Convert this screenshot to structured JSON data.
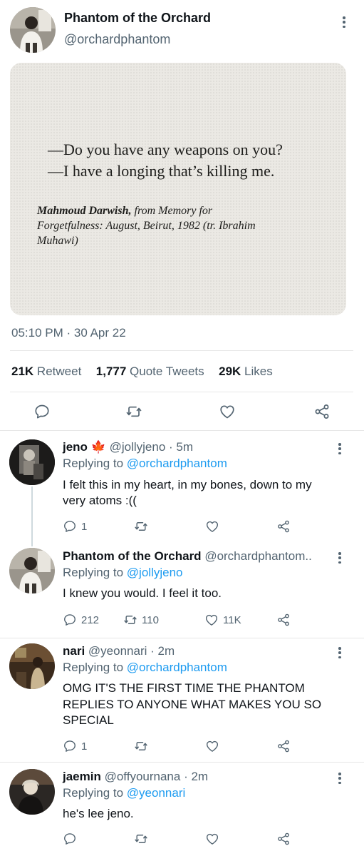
{
  "tweet": {
    "author_name": "Phantom of the Orchard",
    "author_handle": "@orchardphantom",
    "quote_line1": "—Do you have any weapons on you?",
    "quote_line2": "—I have a longing that’s killing me.",
    "attribution_author": "Mahmoud Darwish,",
    "attribution_line1_rest": " from Memory for",
    "attribution_line2": "Forgetfulness: August, Beirut, 1982 (tr. Ibrahim",
    "attribution_line3": "Muhawi)",
    "timestamp": "05:10 PM · 30 Apr 22",
    "stats": {
      "retweets_count": "21K",
      "retweets_label": "Retweet",
      "quotes_count": "1,777",
      "quotes_label": "Quote Tweets",
      "likes_count": "29K",
      "likes_label": "Likes"
    }
  },
  "replies": [
    {
      "name": "jeno",
      "emoji": "🍁",
      "handle": "@jollyjeno",
      "time": "· 5m",
      "replying_prefix": "Replying to",
      "replying_to": "@orchardphantom",
      "text_line1": "I felt this in my heart, in my bones, down to my",
      "text_line2": "very atoms :((",
      "reply_count": "1",
      "retweet_count": "",
      "like_count": ""
    },
    {
      "name": "Phantom of the Orchard",
      "handle": "@orchardphantom..",
      "replying_prefix": "Replying to",
      "replying_to": "@jollyjeno",
      "text_line1": "I knew you would. I feel it too.",
      "reply_count": "212",
      "retweet_count": "110",
      "like_count": "11K"
    },
    {
      "name": "nari",
      "handle": "@yeonnari",
      "time": "· 2m",
      "replying_prefix": "Replying to",
      "replying_to": "@orchardphantom",
      "text_line1": "OMG IT'S THE FIRST TIME THE PHANTOM",
      "text_line2": "REPLIES TO ANYONE WHAT MAKES YOU SO",
      "text_line3": "SPECIAL",
      "reply_count": "1",
      "retweet_count": "",
      "like_count": ""
    },
    {
      "name": "jaemin",
      "handle": "@offyournana",
      "time": "· 2m",
      "replying_prefix": "Replying to",
      "replying_to": "@yeonnari",
      "text_line1": "he's lee jeno.",
      "reply_count": "",
      "retweet_count": "",
      "like_count": ""
    }
  ],
  "icons": {
    "reply": "speech-bubble-icon",
    "retweet": "retweet-arrows-icon",
    "like": "heart-icon",
    "share": "share-nodes-icon",
    "more": "vertical-dots-icon"
  },
  "colors": {
    "link": "#1d9bf0",
    "muted": "#536471",
    "text": "#0f1419",
    "maple": "#d6452c"
  }
}
